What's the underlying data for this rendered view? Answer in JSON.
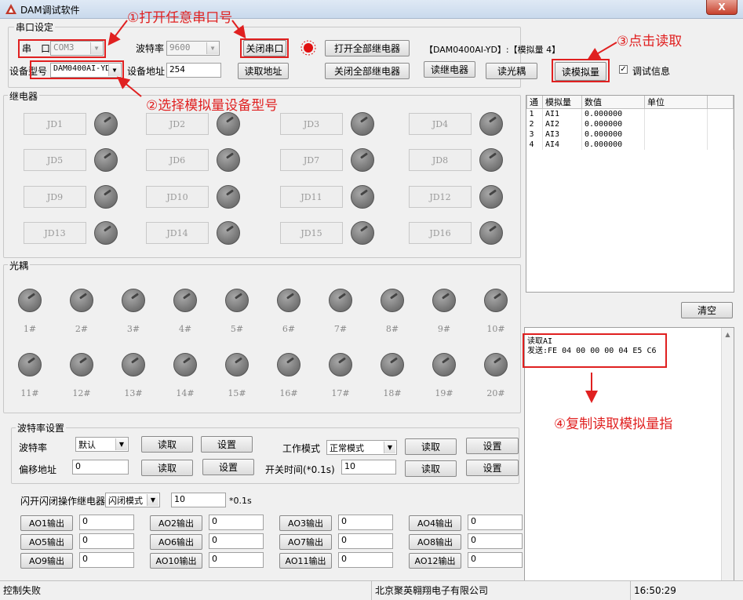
{
  "window": {
    "title": "DAM调试软件",
    "close_label": "X"
  },
  "serial": {
    "group_label": "串口设定",
    "port_label": "串　口",
    "port_value": "COM3",
    "baud_label": "波特率",
    "baud_value": "9600",
    "close_port_btn": "关闭串口",
    "open_all_btn": "打开全部继电器",
    "close_all_btn": "关闭全部继电器",
    "model_label": "设备型号",
    "model_value": "DAM0400AI-YD",
    "addr_label": "设备地址",
    "addr_value": "254",
    "read_addr_btn": "读取地址",
    "read_relay_btn": "读继电器",
    "read_optocoupler_btn": "读光耦",
    "read_analog_btn": "读模拟量",
    "device_info": "【DAM0400AI-YD】:【模拟量 4】",
    "debug_label": "调试信息",
    "debug_checked": true,
    "status_led_color": "#e01010"
  },
  "relay": {
    "group_label": "继电器",
    "buttons": [
      "JD1",
      "JD2",
      "JD3",
      "JD4",
      "JD5",
      "JD6",
      "JD7",
      "JD8",
      "JD9",
      "JD10",
      "JD11",
      "JD12",
      "JD13",
      "JD14",
      "JD15",
      "JD16"
    ]
  },
  "optocoupler": {
    "group_label": "光耦",
    "labels": [
      "1#",
      "2#",
      "3#",
      "4#",
      "5#",
      "6#",
      "7#",
      "8#",
      "9#",
      "10#",
      "11#",
      "12#",
      "13#",
      "14#",
      "15#",
      "16#",
      "17#",
      "18#",
      "19#",
      "20#"
    ]
  },
  "analog_table": {
    "columns": [
      "通",
      "模拟量",
      "数值",
      "单位"
    ],
    "rows": [
      [
        "1",
        "AI1",
        "0.000000",
        ""
      ],
      [
        "2",
        "AI2",
        "0.000000",
        ""
      ],
      [
        "3",
        "AI3",
        "0.000000",
        ""
      ],
      [
        "4",
        "AI4",
        "0.000000",
        ""
      ]
    ]
  },
  "clear_btn": "清空",
  "log": {
    "line1": "读取AI",
    "line2": "发送:FE 04 00 00 00 04 E5 C6"
  },
  "baud_settings": {
    "group_label": "波特率设置",
    "baud_label": "波特率",
    "baud_value": "默认",
    "read_btn": "读取",
    "set_btn": "设置",
    "work_mode_label": "工作模式",
    "work_mode_value": "正常模式",
    "offset_label": "偏移地址",
    "offset_value": "0",
    "switch_time_label": "开关时间(*0.1s)",
    "switch_time_value": "10"
  },
  "flash": {
    "label": "闪开闪闭操作继电器",
    "mode_value": "闪闭模式",
    "time_value": "10",
    "unit": "*0.1s"
  },
  "ao_outputs": [
    {
      "label": "AO1输出",
      "value": "0"
    },
    {
      "label": "AO2输出",
      "value": "0"
    },
    {
      "label": "AO3输出",
      "value": "0"
    },
    {
      "label": "AO4输出",
      "value": "0"
    },
    {
      "label": "AO5输出",
      "value": "0"
    },
    {
      "label": "AO6输出",
      "value": "0"
    },
    {
      "label": "AO7输出",
      "value": "0"
    },
    {
      "label": "AO8输出",
      "value": "0"
    },
    {
      "label": "AO9输出",
      "value": "0"
    },
    {
      "label": "AO10输出",
      "value": "0"
    },
    {
      "label": "AO11输出",
      "value": "0"
    },
    {
      "label": "AO12输出",
      "value": "0"
    }
  ],
  "status": {
    "message": "控制失败",
    "company": "北京聚英翱翔电子有限公司",
    "time": "16:50:29"
  },
  "annotations": {
    "step1": "①打开任意串口号",
    "step2": "②选择模拟量设备型号",
    "step3": "③点击读取",
    "step4": "④复制读取模拟量指",
    "color": "#e02020"
  }
}
